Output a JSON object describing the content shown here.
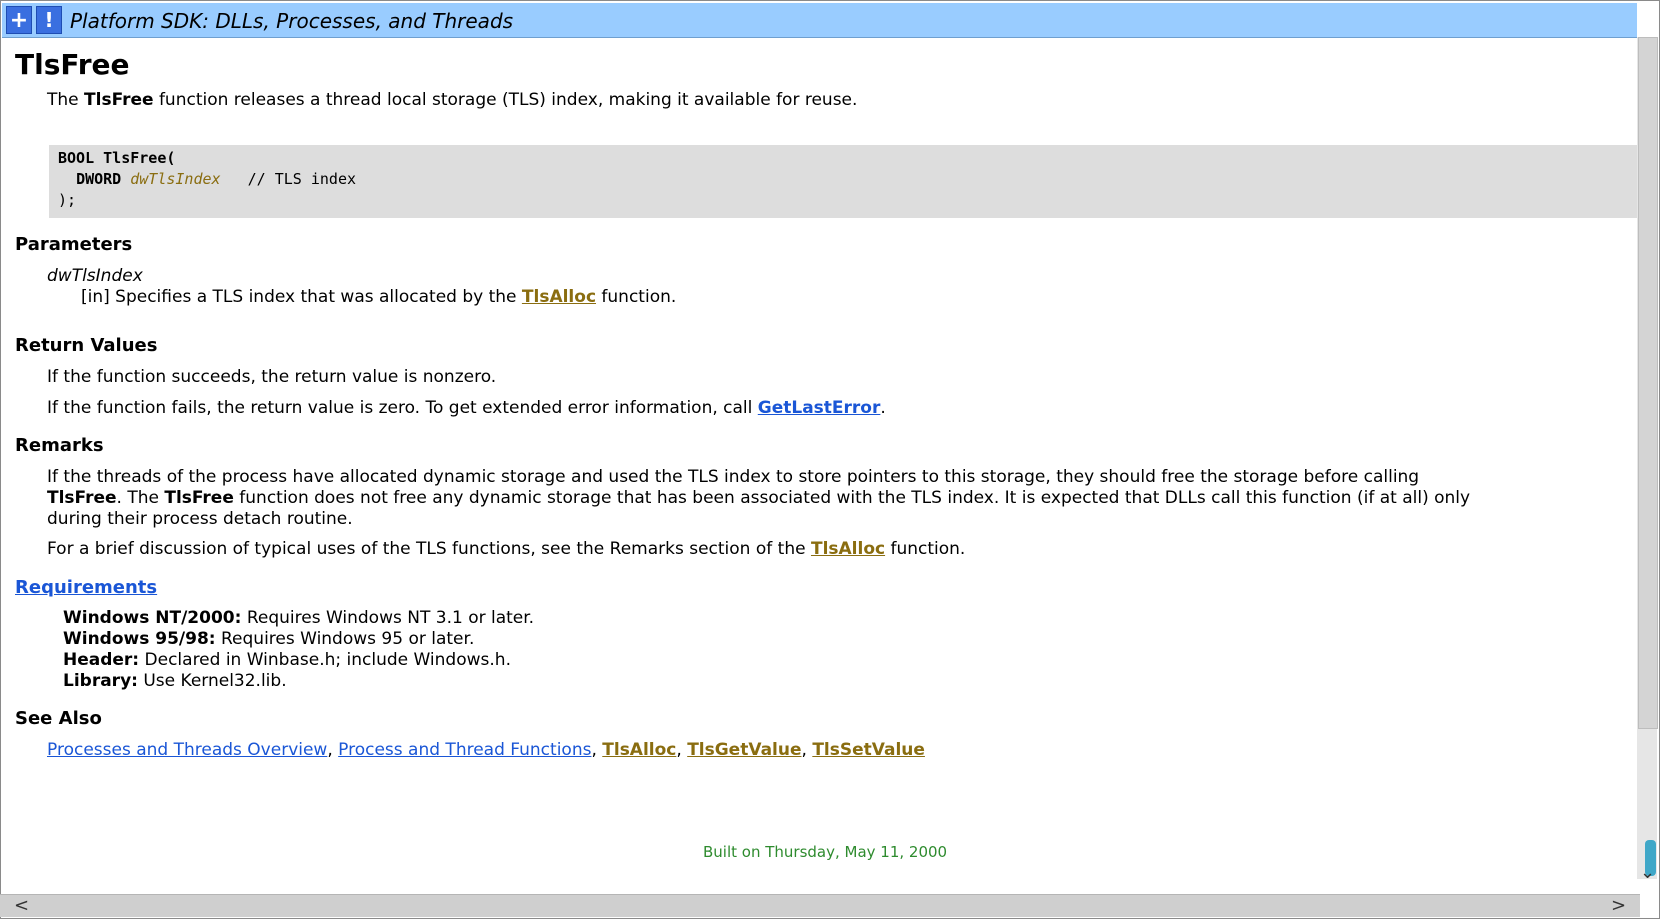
{
  "header": {
    "title": "Platform SDK: DLLs, Processes, and Threads",
    "btn_plus": "+",
    "btn_bang": "!"
  },
  "page": {
    "title": "TlsFree",
    "intro": {
      "pre": "The ",
      "bold": "TlsFree",
      "post": " function releases a thread local storage (TLS) index, making it available for reuse."
    },
    "code": {
      "line1": "BOOL TlsFree(",
      "line2_type": "DWORD ",
      "line2_param": "dwTlsIndex",
      "line2_comment": "   // TLS index",
      "line3": ");"
    },
    "parameters": {
      "heading": "Parameters",
      "name": "dwTlsIndex",
      "desc_pre": "[in] Specifies a TLS index that was allocated by the ",
      "desc_link": "TlsAlloc",
      "desc_post": " function."
    },
    "return_values": {
      "heading": "Return Values",
      "p1": "If the function succeeds, the return value is nonzero.",
      "p2_pre": "If the function fails, the return value is zero. To get extended error information, call ",
      "p2_link": "GetLastError",
      "p2_post": "."
    },
    "remarks": {
      "heading": "Remarks",
      "p1_a": "If the threads of the process have allocated dynamic storage and used the TLS index to store pointers to this storage, they should free the storage before calling",
      "p1_b_bold": "TlsFree",
      "p1_b_mid": ". The ",
      "p1_b_bold2": "TlsFree",
      "p1_b_post": " function does not free any dynamic storage that has been associated with the TLS index. It is expected that DLLs call this function (if at all) only",
      "p1_c": "during their process detach routine.",
      "p2_pre": "For a brief discussion of typical uses of the TLS functions, see the Remarks section of the ",
      "p2_link": "TlsAlloc",
      "p2_post": " function."
    },
    "requirements": {
      "heading": "Requirements",
      "items": [
        {
          "label": "Windows NT/2000:",
          "value": " Requires Windows NT 3.1 or later."
        },
        {
          "label": "Windows 95/98:",
          "value": " Requires Windows 95 or later."
        },
        {
          "label": "Header:",
          "value": " Declared in Winbase.h; include Windows.h."
        },
        {
          "label": "Library:",
          "value": " Use Kernel32.lib."
        }
      ]
    },
    "see_also": {
      "heading": "See Also",
      "links": [
        "Processes and Threads Overview",
        "Process and Thread Functions",
        "TlsAlloc",
        "TlsGetValue",
        "TlsSetValue"
      ],
      "sep": ", "
    },
    "footer": "Built on Thursday, May 11, 2000"
  },
  "scroll": {
    "left_arrow": "<",
    "right_arrow": ">",
    "down_arrow": "⌄"
  }
}
